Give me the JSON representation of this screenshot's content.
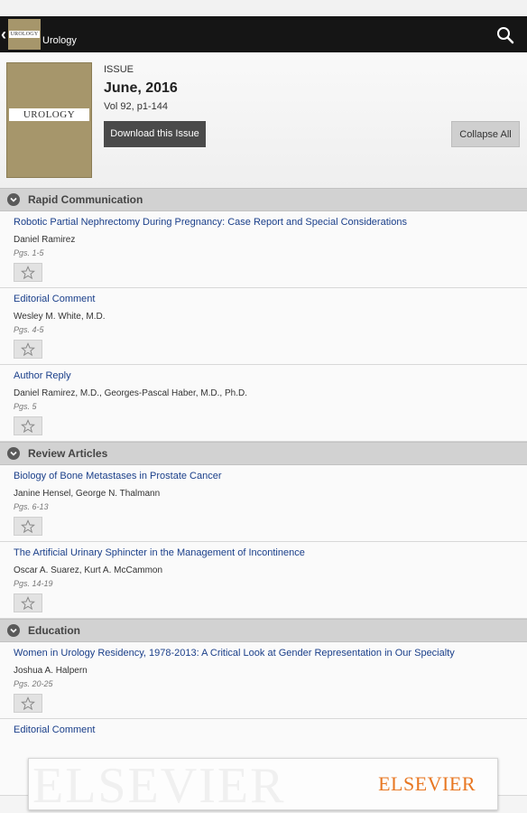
{
  "app": {
    "title": "Urology",
    "logo_text": "UROLOGY",
    "icons": {
      "back": "chevron-left-icon",
      "search": "search-icon",
      "star": "star-icon",
      "section": "chevron-down-icon"
    }
  },
  "issue": {
    "label": "ISSUE",
    "date": "June, 2016",
    "volume": "Vol 92, p1-144",
    "cover_text": "UROLOGY",
    "download_label": "Download this Issue",
    "collapse_label": "Collapse All"
  },
  "sections": [
    {
      "title": "Rapid Communication",
      "articles": [
        {
          "title": "Robotic Partial Nephrectomy During Pregnancy: Case Report and Special Considerations",
          "authors": "Daniel Ramirez",
          "pages": "Pgs. 1-5"
        },
        {
          "title": "Editorial Comment",
          "authors": "Wesley M. White, M.D.",
          "pages": "Pgs. 4-5"
        },
        {
          "title": "Author Reply",
          "authors": "Daniel Ramirez, M.D., Georges-Pascal Haber, M.D., Ph.D.",
          "pages": "Pgs. 5"
        }
      ]
    },
    {
      "title": "Review Articles",
      "articles": [
        {
          "title": "Biology of Bone Metastases in Prostate Cancer",
          "authors": "Janine Hensel, George N. Thalmann",
          "pages": "Pgs. 6-13"
        },
        {
          "title": "The Artificial Urinary Sphincter in the Management of Incontinence",
          "authors": "Oscar A. Suarez, Kurt A. McCammon",
          "pages": "Pgs. 14-19"
        }
      ]
    },
    {
      "title": "Education",
      "articles": [
        {
          "title": "Women in Urology Residency, 1978-2013: A Critical Look at Gender Representation in Our Specialty",
          "authors": "Joshua A. Halpern",
          "pages": "Pgs. 20-25"
        },
        {
          "title": "Editorial Comment",
          "authors": "",
          "pages": ""
        }
      ]
    }
  ],
  "ad": {
    "logo": "ELSEVIER",
    "watermark": "ELSEVIER",
    "logo_color": "#e87722"
  },
  "colors": {
    "action_bar": "#151515",
    "link": "#1a3f8a",
    "cover": "#a6966b"
  }
}
